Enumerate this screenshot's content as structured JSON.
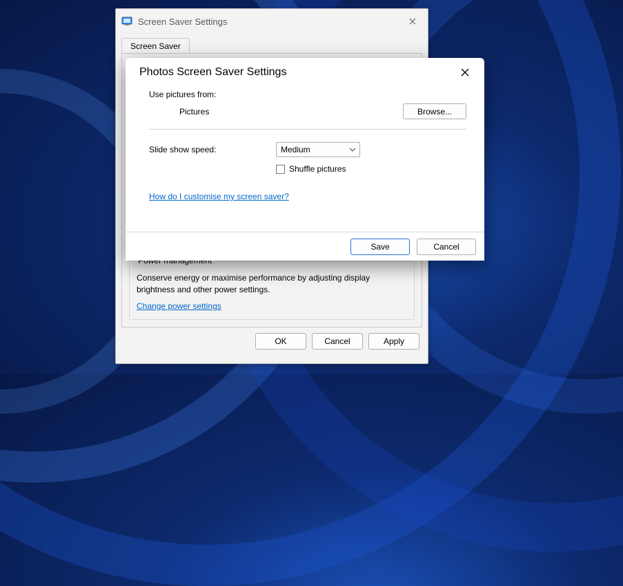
{
  "parent": {
    "title": "Screen Saver Settings",
    "tab_label": "Screen Saver",
    "power": {
      "group_title": "Power management",
      "text": "Conserve energy or maximise performance by adjusting display brightness and other power settings.",
      "link": "Change power settings"
    },
    "buttons": {
      "ok": "OK",
      "cancel": "Cancel",
      "apply": "Apply"
    }
  },
  "child": {
    "title": "Photos Screen Saver Settings",
    "use_from_label": "Use pictures from:",
    "pictures_label": "Pictures",
    "browse_label": "Browse...",
    "speed_label": "Slide show speed:",
    "speed_value": "Medium",
    "shuffle_label": "Shuffle pictures",
    "help_link": "How do I customise my screen saver?",
    "buttons": {
      "save": "Save",
      "cancel": "Cancel"
    }
  }
}
